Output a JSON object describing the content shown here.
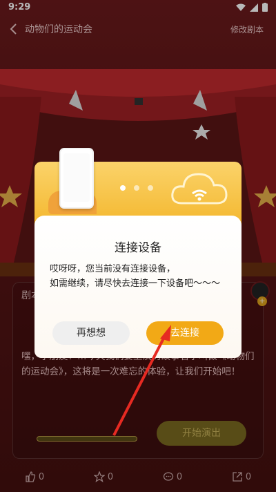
{
  "status": {
    "time": "9:29"
  },
  "header": {
    "title": "动物们的运动会",
    "edit_label": "修改剧本"
  },
  "script_card": {
    "label": "剧本",
    "description": "嘿，小朋友！…今天我们要上演的故事名字叫做《动物们的运动会》，这将是一次难忘的体验，让我们开始吧！",
    "start_button": "开始演出",
    "progress_percent": 0,
    "progress_label": "0%"
  },
  "bottom_bar": {
    "likes": "0",
    "favorites": "0",
    "comments": "0",
    "shares": "0"
  },
  "dialog": {
    "title": "连接设备",
    "message_line1": "哎呀呀，您当前没有连接设备，",
    "message_line2": "如需继续，请尽快去连接一下设备吧～～～",
    "cancel_button": "再想想",
    "confirm_button": "去连接",
    "carousel_active_index": 0
  },
  "colors": {
    "accent": "#f2a916",
    "background": "#5a1416"
  }
}
